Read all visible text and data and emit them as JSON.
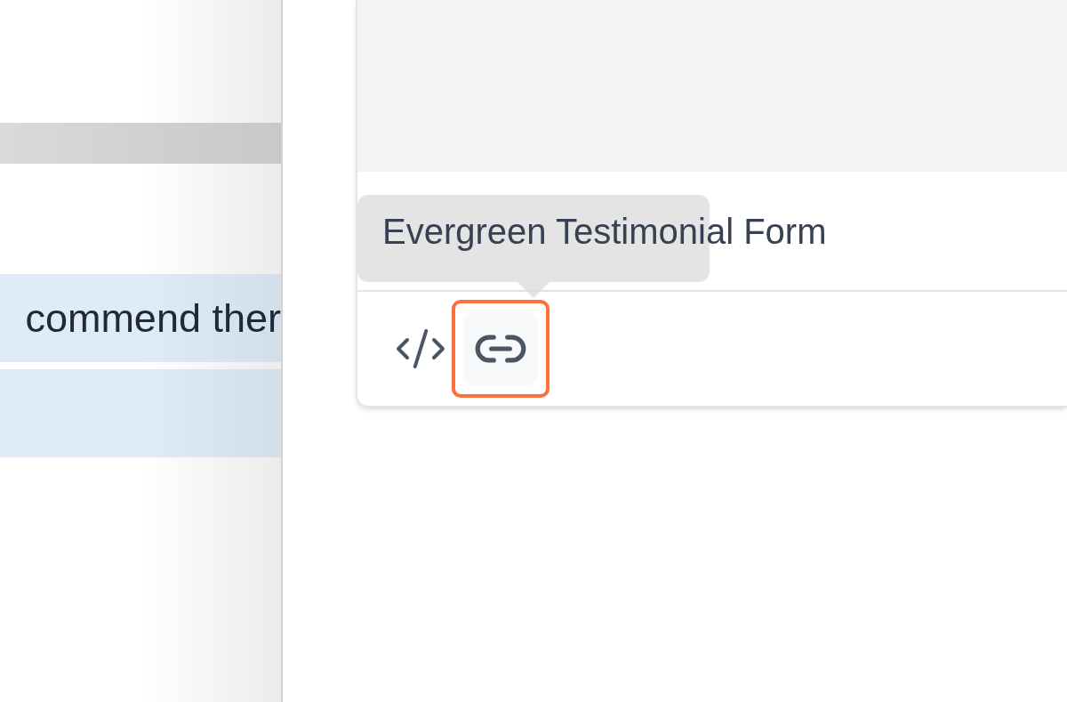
{
  "left_panel": {
    "rows": [
      {
        "text": "commend ther",
        "selected": true
      },
      {
        "selected": true
      }
    ]
  },
  "form_card": {
    "title": "Evergreen Testimonial Form",
    "actions": [
      {
        "kind": "embed",
        "highlighted": false
      },
      {
        "kind": "link",
        "highlighted": true
      }
    ]
  },
  "tooltip": {
    "visible": true
  }
}
